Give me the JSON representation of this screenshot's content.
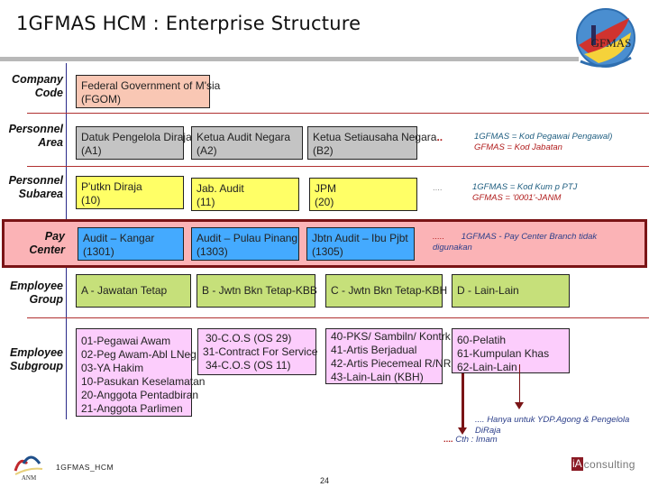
{
  "slide": {
    "title": "1GFMAS HCM : Enterprise Structure",
    "page_number": "24",
    "footer_label": "1GFMAS_HCM"
  },
  "logos": {
    "top_right": {
      "name": "gfmas-logo",
      "text": "GFMAS"
    },
    "bottom_left": {
      "name": "anm-logo",
      "text": "ANM"
    },
    "bottom_right": {
      "name": "iaconsulting-logo",
      "mark": "iA",
      "text": "consulting"
    }
  },
  "rows": {
    "company_code": {
      "label_line1": "Company",
      "label_line2": "Code"
    },
    "personnel_area": {
      "label_line1": "Personnel",
      "label_line2": "Area"
    },
    "personnel_subarea": {
      "label_line1": "Personnel",
      "label_line2": "Subarea"
    },
    "pay_center": {
      "label_line1": "Pay",
      "label_line2": "Center"
    },
    "employee_group": {
      "label_line1": "Employee",
      "label_line2": "Group"
    },
    "employee_subgroup": {
      "label_line1": "Employee",
      "label_line2": "Subgroup"
    }
  },
  "company_code_boxes": [
    {
      "line1": "Federal Government of M'sia",
      "line2": "(FGOM)"
    }
  ],
  "personnel_area_boxes": [
    {
      "line1": "Datuk Pengelola Diraja",
      "line2": "(A1)"
    },
    {
      "line1": "Ketua Audit Negara",
      "line2": "(A2)"
    },
    {
      "line1": "Ketua Setiausaha Negara",
      "line2": "(B2)",
      "suffix": ".."
    }
  ],
  "personnel_area_notes": {
    "line1": "1GFMAS  = Kod Pegawai Pengawal)",
    "line2": "GFMAS    = Kod Jabatan"
  },
  "personnel_subarea_boxes": [
    {
      "line1": "P'utkn Diraja",
      "line2": "(10)"
    },
    {
      "line1": "Jab. Audit",
      "line2": "(11)"
    },
    {
      "line1": "JPM",
      "line2": "(20)"
    }
  ],
  "personnel_subarea_notes": {
    "ellipsis": "....",
    "line1": "1GFMAS  = Kod Kum p PTJ",
    "line2": "GFMAS    = '0001'-JANM"
  },
  "pay_center_boxes": [
    {
      "line1": "Audit – Kangar",
      "line2": "(1301)"
    },
    {
      "line1": "Audit – Pulau Pinang",
      "line2": "(1303)"
    },
    {
      "line1": "Jbtn Audit – Ibu Pjbt",
      "line2": "(1305)"
    }
  ],
  "pay_center_note": {
    "ellipsis": ".....",
    "line1": "1GFMAS -  Pay Center Branch tidak",
    "line2": "digunakan"
  },
  "employee_group_boxes": [
    {
      "label": "A - Jawatan Tetap"
    },
    {
      "label": "B - Jwtn Bkn Tetap-KBB"
    },
    {
      "label": "C - Jwtn Bkn Tetap-KBH"
    },
    {
      "label": "D - Lain-Lain"
    }
  ],
  "employee_subgroup_boxes": [
    {
      "items": [
        "01-Pegawai Awam",
        "02-Peg Awam-Abl LNeg",
        "03-YA Hakim",
        "10-Pasukan Keselamatan",
        "20-Anggota Pentadbiran",
        "21-Anggota Parlimen"
      ]
    },
    {
      "items": [
        "30-C.O.S (OS 29)",
        "31-Contract For Service",
        "34-C.O.S (OS 11)"
      ]
    },
    {
      "items": [
        "40-PKS/ Sambiln/ Kontrk",
        "41-Artis Berjadual",
        "42-Artis Piecemeal R/NR",
        "43-Lain-Lain (KBH)"
      ]
    },
    {
      "items": [
        "60-Pelatih",
        "61-Kumpulan Khas",
        "62-Lain-Lain"
      ]
    }
  ],
  "subgroup_notes": {
    "agong_note_line1": ".... Hanya untuk YDP.Agong & Pengelola",
    "agong_note_line2": "DiRaja",
    "imam_ellipsis": "....",
    "imam_note": "Cth : Imam"
  },
  "colors": {
    "peach": "#f9c7b4",
    "grey": "#c4c4c4",
    "yellow": "#ffff66",
    "blue": "#44aaff",
    "green": "#c6e07a",
    "pink": "#fccdfc",
    "pay_panel": "#fbb3b6",
    "maroon": "#7a1416"
  }
}
